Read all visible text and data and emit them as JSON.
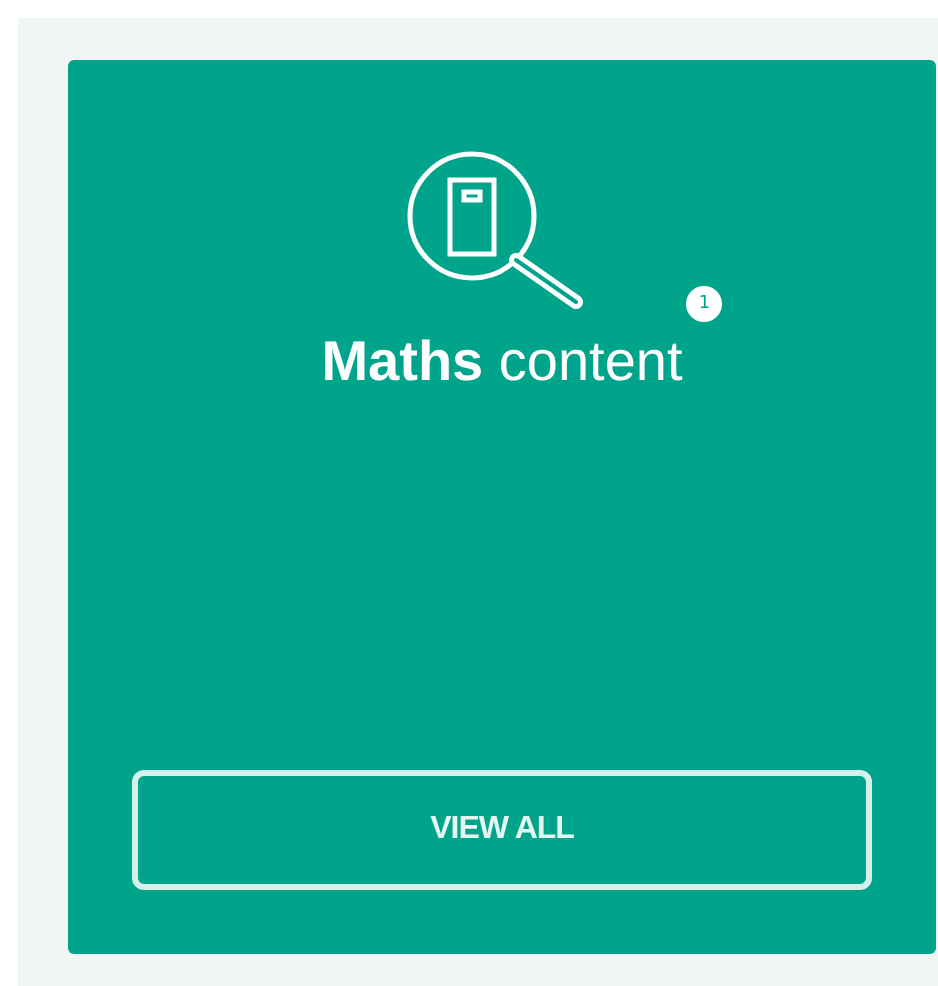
{
  "card": {
    "title": "**Maths** content",
    "badge": "1",
    "button": "VIEW ALL"
  }
}
